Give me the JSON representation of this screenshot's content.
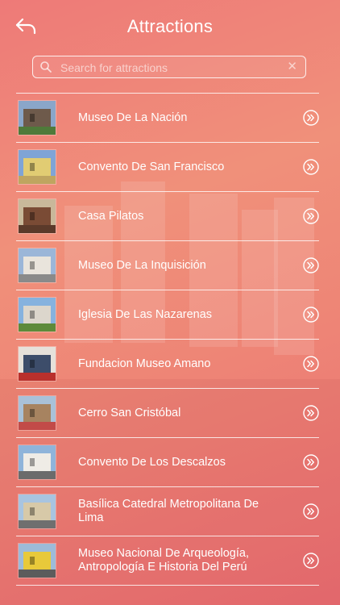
{
  "header": {
    "title": "Attractions",
    "back_icon": "back-arrow-icon"
  },
  "search": {
    "placeholder": "Search for attractions",
    "value": "",
    "icon": "search-icon",
    "clear_icon": "close-icon"
  },
  "attractions": [
    {
      "name": "Museo De La Nación",
      "thumb_colors": [
        "#8aa6c9",
        "#6e5a4b",
        "#4f7a3a"
      ]
    },
    {
      "name": "Convento De San Francisco",
      "thumb_colors": [
        "#7fa4d6",
        "#e1cc73",
        "#bfa560"
      ]
    },
    {
      "name": "Casa Pilatos",
      "thumb_colors": [
        "#c9b89a",
        "#7a4b35",
        "#5b3a2a"
      ]
    },
    {
      "name": "Museo De La Inquisición",
      "thumb_colors": [
        "#9bb6d8",
        "#e9e4dc",
        "#8a8a8a"
      ]
    },
    {
      "name": "Iglesia De Las Nazarenas",
      "thumb_colors": [
        "#86b2de",
        "#dcd6cc",
        "#5d8a3a"
      ]
    },
    {
      "name": "Fundacion Museo Amano",
      "thumb_colors": [
        "#e6e1da",
        "#3d4d6a",
        "#b9302c"
      ]
    },
    {
      "name": "Cerro San Cristóbal",
      "thumb_colors": [
        "#a9c1d8",
        "#a78360",
        "#c24b48"
      ]
    },
    {
      "name": "Convento De Los Descalzos",
      "thumb_colors": [
        "#8fb4da",
        "#efece6",
        "#6b6b6b"
      ]
    },
    {
      "name": "Basílica Catedral Metropolitana De Lima",
      "thumb_colors": [
        "#a8c4e0",
        "#d7c9a8",
        "#6f6f6f"
      ]
    },
    {
      "name": "Museo Nacional De Arqueología, Antropología E Historia Del Perú",
      "thumb_colors": [
        "#9dbbd9",
        "#e8c93a",
        "#5c5c5c"
      ]
    }
  ],
  "row_chevron_icon": "chevron-right-circle-icon"
}
